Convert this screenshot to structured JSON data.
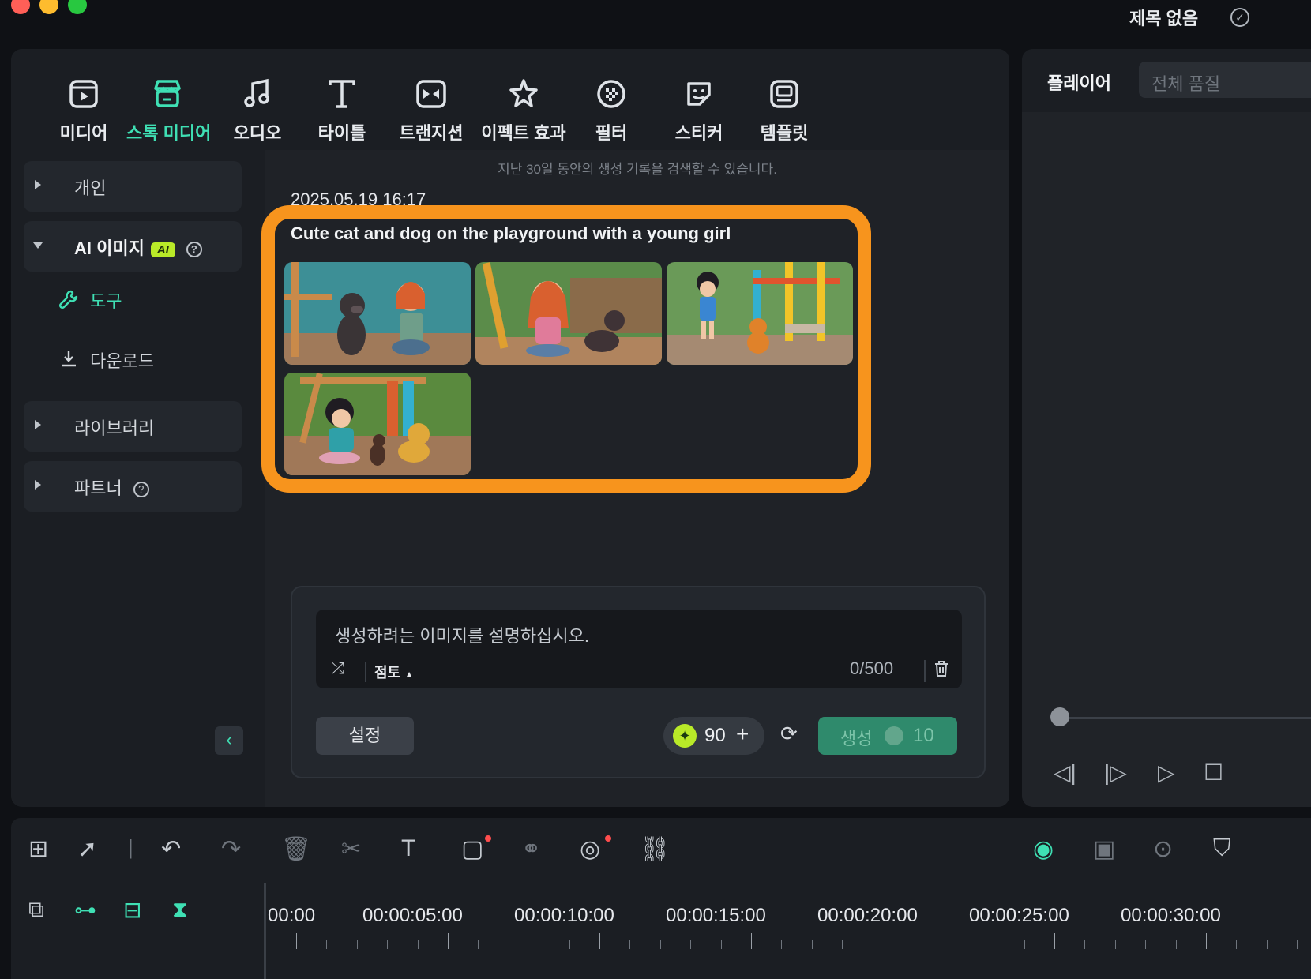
{
  "window": {
    "project_title": "제목 없음",
    "traffic_colors": [
      "#ff5f57",
      "#febc2e",
      "#28c840"
    ]
  },
  "media_tabs": [
    {
      "label": "미디어",
      "icon": "media-icon"
    },
    {
      "label": "스톡 미디어",
      "icon": "stock-store-icon",
      "active": true
    },
    {
      "label": "오디오",
      "icon": "music-note-icon"
    },
    {
      "label": "타이틀",
      "icon": "title-t-icon"
    },
    {
      "label": "트랜지션",
      "icon": "transition-icon"
    },
    {
      "label": "이펙트 효과",
      "icon": "effect-star-icon"
    },
    {
      "label": "필터",
      "icon": "filter-icon"
    },
    {
      "label": "스티커",
      "icon": "sticker-icon"
    },
    {
      "label": "템플릿",
      "icon": "template-icon"
    }
  ],
  "sidebar": {
    "items": [
      {
        "label": "개인"
      },
      {
        "label": "AI 이미지",
        "badge": "AI",
        "expanded": true
      },
      {
        "label": "라이브러리"
      },
      {
        "label": "파트너"
      }
    ],
    "sub_items": [
      {
        "label": "도구",
        "icon": "wrench-icon",
        "active": true
      },
      {
        "label": "다운로드",
        "icon": "download-icon"
      }
    ]
  },
  "history": {
    "note": "지난 30일 동안의 생성 기록을 검색할 수 있습니다.",
    "date": "2025.05.19 16:17",
    "prompt": "Cute cat and dog on the playground with a young girl"
  },
  "prompt_panel": {
    "placeholder": "생성하려는 이미지를 설명하십시오.",
    "style": "점토",
    "char_count": "0/500",
    "settings_label": "설정",
    "credits": "90",
    "generate_label": "생성",
    "generate_cost": "10"
  },
  "player": {
    "title": "플레이어",
    "quality": "전체 품질"
  },
  "timeline": {
    "timecodes": [
      "00:00",
      "00:00:05:00",
      "00:00:10:00",
      "00:00:15:00",
      "00:00:20:00",
      "00:00:25:00",
      "00:00:30:00"
    ]
  },
  "colors": {
    "accent": "#3fe0b4",
    "highlight": "#f7941d",
    "ai_badge": "#b9ea28",
    "generate_bg": "#2f8a6c"
  }
}
